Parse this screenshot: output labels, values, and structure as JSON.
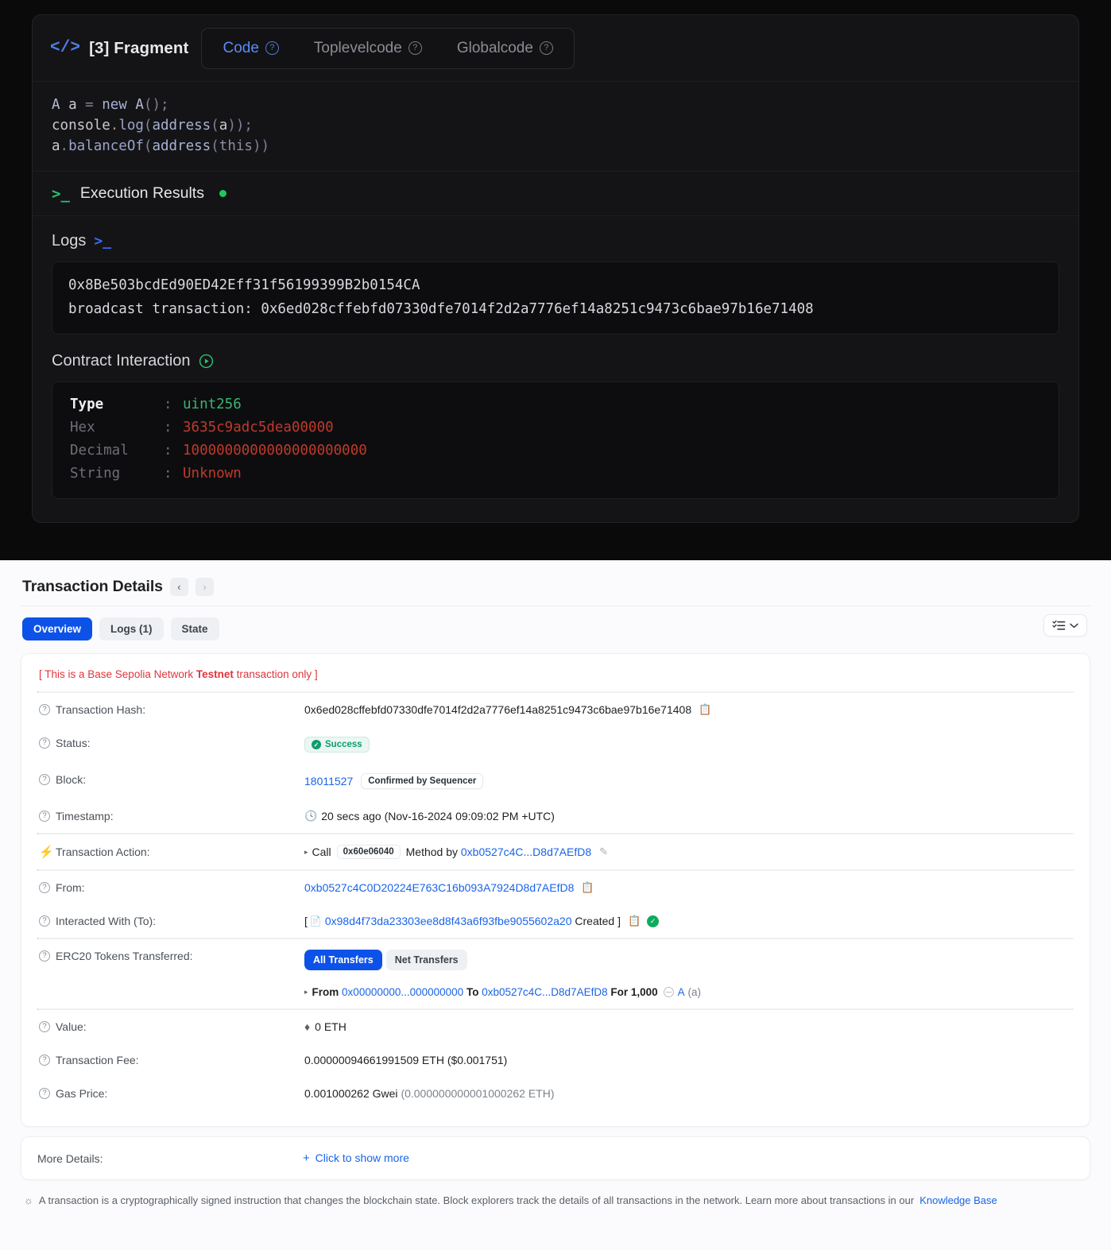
{
  "fragment": {
    "code_icon": "code-brackets-icon",
    "title": "[3] Fragment",
    "tabs": [
      {
        "label": "Code",
        "active": true
      },
      {
        "label": "Toplevelcode",
        "active": false
      },
      {
        "label": "Globalcode",
        "active": false
      }
    ],
    "code_lines": [
      "A a = new A();",
      "console.log(address(a));",
      "a.balanceOf(address(this))"
    ],
    "execution": {
      "label": "Execution Results",
      "status_color": "#22c55e"
    },
    "logs": {
      "title": "Logs",
      "lines": [
        "0x8Be503bcdEd90ED42Eff31f56199399B2b0154CA",
        "broadcast transaction: 0x6ed028cffebfd07330dfe7014f2d2a7776ef14a8251c9473c6bae97b16e71408"
      ]
    },
    "contract_interaction": {
      "title": "Contract Interaction",
      "rows": [
        {
          "key": "Type",
          "value": "uint256",
          "value_color": "green"
        },
        {
          "key": "Hex",
          "value": "3635c9adc5dea00000",
          "value_color": "red"
        },
        {
          "key": "Decimal",
          "value": "1000000000000000000000",
          "value_color": "red"
        },
        {
          "key": "String",
          "value": "Unknown",
          "value_color": "red"
        }
      ]
    }
  },
  "explorer": {
    "title": "Transaction Details",
    "nav": {
      "prev": "‹",
      "next": "›"
    },
    "tabs": [
      {
        "label": "Overview",
        "active": true
      },
      {
        "label": "Logs (1)",
        "active": false
      },
      {
        "label": "State",
        "active": false
      }
    ],
    "testnet_note": {
      "prefix": "[ This is a Base Sepolia Network ",
      "bold": "Testnet",
      "suffix": " transaction only ]"
    },
    "rows": {
      "tx_hash_label": "Transaction Hash:",
      "tx_hash_value": "0x6ed028cffebfd07330dfe7014f2d2a7776ef14a8251c9473c6bae97b16e71408",
      "status_label": "Status:",
      "status_value": "Success",
      "block_label": "Block:",
      "block_value": "18011527",
      "block_badge": "Confirmed by Sequencer",
      "timestamp_label": "Timestamp:",
      "timestamp_value": "20 secs ago (Nov-16-2024 09:09:02 PM +UTC)",
      "action_label": "Transaction Action:",
      "action_call": "Call",
      "action_method": "0x60e06040",
      "action_by_text": "Method by",
      "action_address": "0xb0527c4C...D8d7AEfD8",
      "from_label": "From:",
      "from_value": "0xb0527c4C0D20224E763C16b093A7924D8d7AEfD8",
      "to_label": "Interacted With (To):",
      "to_open": "[",
      "to_value": "0x98d4f73da23303ee8d8f43a6f93fbe9055602a20",
      "to_created": "Created",
      "to_close": "]",
      "erc20_label": "ERC20 Tokens Transferred:",
      "erc20_tab_all": "All Transfers",
      "erc20_tab_net": "Net Transfers",
      "transfer_from_word": "From",
      "transfer_from_addr": "0x00000000...000000000",
      "transfer_to_word": "To",
      "transfer_to_addr": "0xb0527c4C...D8d7AEfD8",
      "transfer_for_word": "For",
      "transfer_amount": "1,000",
      "transfer_token_symbol": "A",
      "transfer_token_name": "(a)",
      "value_label": "Value:",
      "value_value": "0 ETH",
      "fee_label": "Transaction Fee:",
      "fee_value": "0.00000094661991509 ETH ($0.001751)",
      "gas_label": "Gas Price:",
      "gas_value": "0.001000262 Gwei",
      "gas_value_eth": "(0.000000000001000262 ETH)"
    },
    "more_details": {
      "label": "More Details:",
      "link": "Click to show more"
    },
    "footer": {
      "text": "A transaction is a cryptographically signed instruction that changes the blockchain state. Block explorers track the details of all transactions in the network. Learn more about transactions in our ",
      "link": "Knowledge Base"
    }
  },
  "colors": {
    "accent_blue": "#0d52e8",
    "link_blue": "#1a64e8",
    "success_green": "#0f9d6e",
    "error_red": "#e0353b",
    "dark_bg": "#0a0a0b"
  }
}
